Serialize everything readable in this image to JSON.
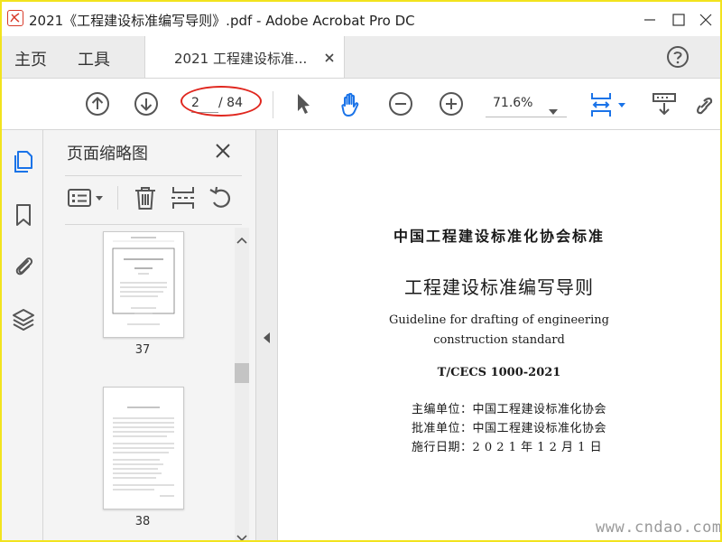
{
  "window": {
    "title": "2021《工程建设标准编写导则》.pdf - Adobe Acrobat Pro DC"
  },
  "tabs": {
    "home": "主页",
    "tools": "工具",
    "document": "2021 工程建设标准..."
  },
  "toolbar": {
    "current_page": "2",
    "total_pages": "/ 84",
    "zoom": "71.6%"
  },
  "icons": {
    "app": "acrobat-icon",
    "minimize": "minimize-icon",
    "maximize": "maximize-icon",
    "close": "close-icon",
    "help": "help-icon",
    "prev_page": "arrow-up-circle-icon",
    "next_page": "arrow-down-circle-icon",
    "select": "cursor-arrow-icon",
    "hand": "hand-icon",
    "zoom_out": "zoom-out-icon",
    "zoom_in": "zoom-in-icon",
    "fit": "fit-page-icon",
    "scroll": "scroll-mode-icon",
    "sign": "sign-icon"
  },
  "panel": {
    "title": "页面缩略图",
    "thumbs": [
      {
        "label": "37"
      },
      {
        "label": "38"
      }
    ]
  },
  "document": {
    "org": "中国工程建设标准化协会标准",
    "title_cn": "工程建设标准编写导则",
    "title_en_1": "Guideline for drafting of engineering",
    "title_en_2": "construction standard",
    "code": "T/CECS 1000-2021",
    "chief_unit": "主编单位：中国工程建设标准化协会",
    "approval_unit": "批准单位：中国工程建设标准化协会",
    "effective_date": "施行日期：2 0 2 1 年 1 2 月 1 日"
  },
  "watermark": "www.cndao.com",
  "colors": {
    "frame": "#f2e31e",
    "accent_blue": "#1a73e8",
    "annotation_red": "#e0271f"
  }
}
